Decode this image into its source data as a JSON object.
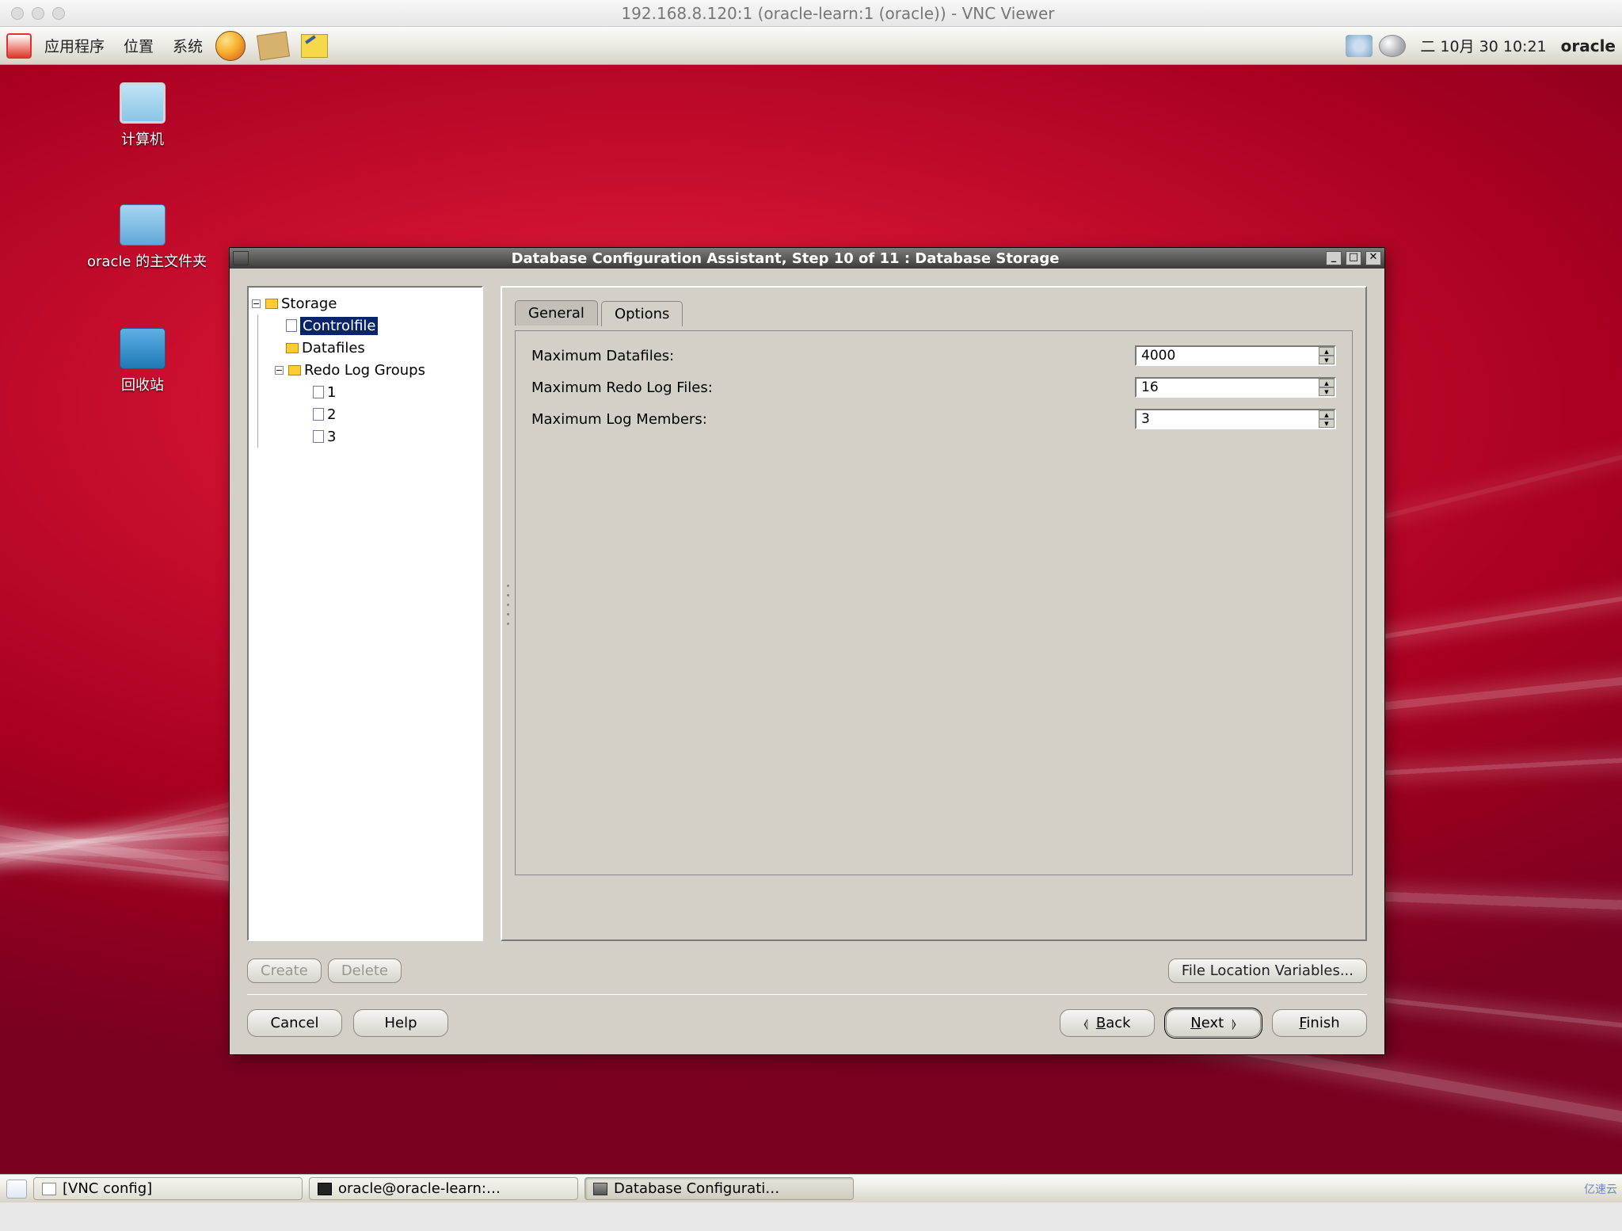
{
  "mac_title": "192.168.8.120:1 (oracle-learn:1 (oracle)) - VNC Viewer",
  "gnome": {
    "apps": "应用程序",
    "places": "位置",
    "system": "系统",
    "clock": "二  10月  30 10:21",
    "user": "oracle"
  },
  "desktop_icons": {
    "computer": "计算机",
    "home": "oracle 的主文件夹",
    "trash": "回收站"
  },
  "dialog": {
    "title": "Database Configuration Assistant, Step 10 of 11 : Database Storage",
    "tree": {
      "root": "Storage",
      "controlfile": "Controlfile",
      "datafiles": "Datafiles",
      "redo": "Redo Log Groups",
      "r1": "1",
      "r2": "2",
      "r3": "3"
    },
    "tabs": {
      "general": "General",
      "options": "Options"
    },
    "fields": {
      "max_datafiles_label": "Maximum Datafiles:",
      "max_datafiles_value": "4000",
      "max_redo_label": "Maximum Redo Log Files:",
      "max_redo_value": "16",
      "max_members_label": "Maximum Log Members:",
      "max_members_value": "3"
    },
    "buttons": {
      "create": "Create",
      "delete": "Delete",
      "file_loc": "File Location Variables...",
      "cancel": "Cancel",
      "help": "Help",
      "back": "Back",
      "next": "Next",
      "finish": "Finish"
    }
  },
  "taskbar": {
    "vnc": "[VNC config]",
    "terminal": "oracle@oracle-learn:…",
    "dbca": "Database Configurati…"
  },
  "watermark": "亿速云"
}
